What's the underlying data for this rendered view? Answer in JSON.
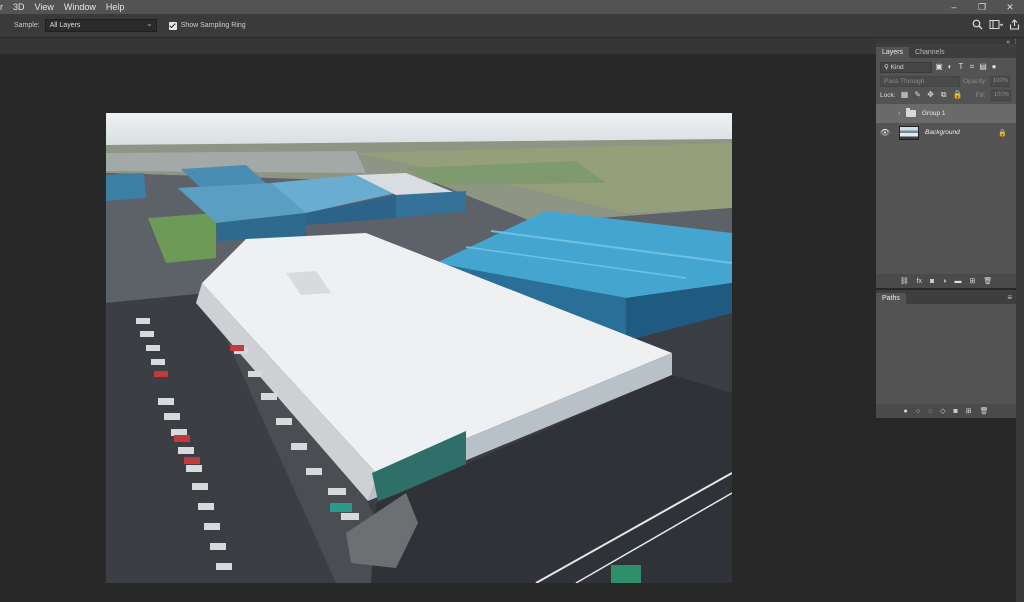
{
  "menu": [
    "r",
    "3D",
    "View",
    "Window",
    "Help"
  ],
  "window_controls": [
    "–",
    "❐",
    "✕"
  ],
  "options_bar": {
    "sample_label": "Sample:",
    "sample_value": "All Layers",
    "sampling_ring_label": "Show Sampling Ring",
    "sampling_ring_checked": true
  },
  "top_right_icons": [
    "search-icon",
    "workspace-icon",
    "share-icon"
  ],
  "panels": {
    "layers": {
      "tabs": [
        "Layers",
        "Channels"
      ],
      "active_tab": "Layers",
      "filter_kind": "Kind",
      "blend_mode": "Pass Through",
      "opacity_label": "Opacity:",
      "opacity_value": "100%",
      "lock_label": "Lock:",
      "fill_label": "Fill:",
      "fill_value": "100%",
      "layers": [
        {
          "name": "Group 1",
          "type": "group",
          "visible": false,
          "selected": true
        },
        {
          "name": "Background",
          "type": "image",
          "visible": true,
          "locked": true
        }
      ],
      "footer_icons": [
        "link-icon",
        "fx-icon",
        "mask-icon",
        "adjustment-icon",
        "folder-icon",
        "new-layer-icon",
        "trash-icon"
      ]
    },
    "paths": {
      "title": "Paths",
      "footer_icons": [
        "fill-path-icon",
        "stroke-path-icon",
        "selection-icon",
        "work-path-icon",
        "mask-icon",
        "new-path-icon",
        "trash-icon"
      ]
    }
  },
  "colors": {
    "menubar": "#535353",
    "options_bar": "#3a3a3a",
    "canvas_bg": "#282828",
    "panel_bg": "#535353",
    "selected_layer": "#6a6a6a"
  }
}
